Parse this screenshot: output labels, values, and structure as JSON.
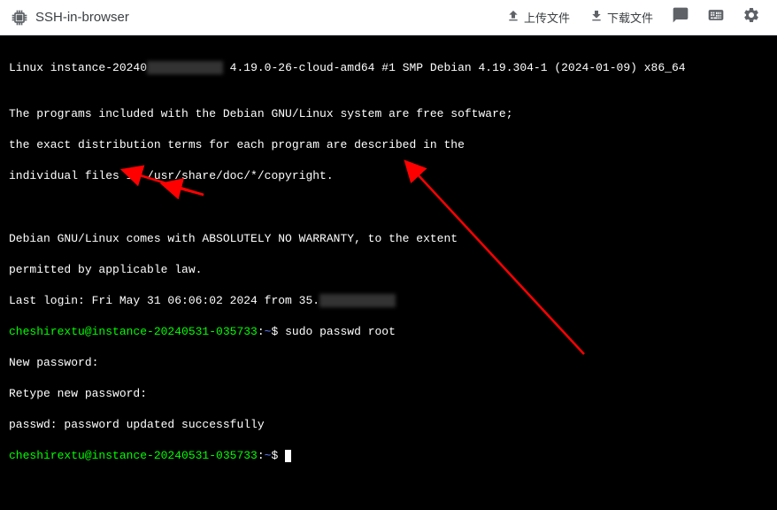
{
  "header": {
    "title": "SSH-in-browser",
    "upload_label": "上传文件",
    "download_label": "下载文件"
  },
  "terminal": {
    "line1_a": "Linux instance-20240",
    "line1_hidden": "xxxxxxxxxxx",
    "line1_b": " 4.19.0-26-cloud-amd64 #1 SMP Debian 4.19.304-1 (2024-01-09) x86_64",
    "blank": "",
    "line2": "The programs included with the Debian GNU/Linux system are free software;",
    "line3": "the exact distribution terms for each program are described in the",
    "line4": "individual files in /usr/share/doc/*/copyright.",
    "line5": "Debian GNU/Linux comes with ABSOLUTELY NO WARRANTY, to the extent",
    "line6": "permitted by applicable law.",
    "line7_a": "Last login: Fri May 31 06:06:02 2024 from 35.",
    "line7_hidden": "xxxxxxxxxxx",
    "prompt1_user": "cheshirextu@instance-20240531-035733",
    "prompt_sep": ":",
    "prompt_path": "~",
    "prompt_dollar": "$ ",
    "cmd1": "sudo passwd root",
    "out1": "New password:",
    "out2": "Retype new password:",
    "out3": "passwd: password updated successfully",
    "prompt2_user": "cheshirextu@instance-20240531-035733"
  }
}
